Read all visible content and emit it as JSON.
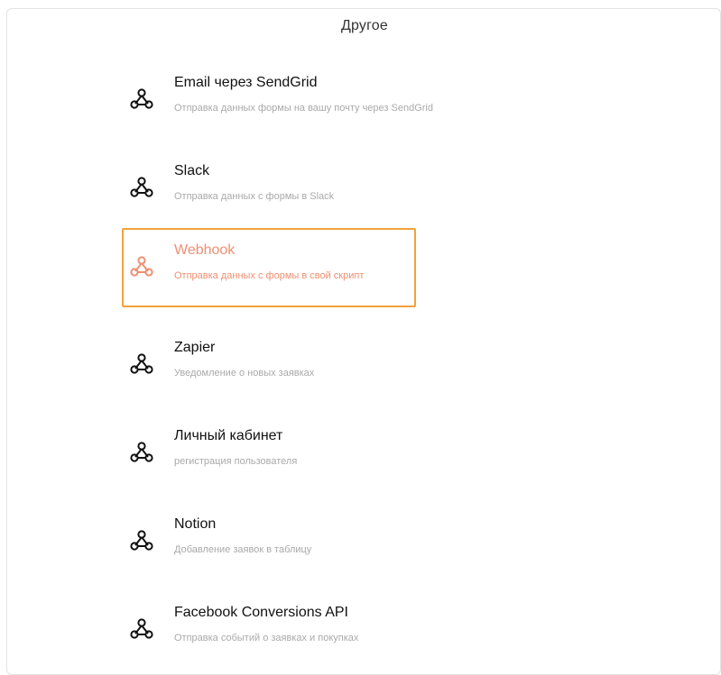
{
  "section_title": "Другое",
  "colors": {
    "highlight_border": "#f2a23a",
    "highlight_text": "#ef8f71",
    "title_text": "#111111",
    "desc_text": "#a9a9a9"
  },
  "items": [
    {
      "title": "Email через SendGrid",
      "desc": "Отправка данных формы на вашу почту через SendGrid",
      "icon": "webhook-icon",
      "active": false
    },
    {
      "title": "Slack",
      "desc": "Отправка данных с формы в Slack",
      "icon": "webhook-icon",
      "active": false
    },
    {
      "title": "Webhook",
      "desc": "Отправка данных с формы в свой скрипт",
      "icon": "webhook-icon",
      "active": true
    },
    {
      "title": "Zapier",
      "desc": "Уведомление о новых заявках",
      "icon": "webhook-icon",
      "active": false
    },
    {
      "title": "Личный кабинет",
      "desc": "регистрация пользователя",
      "icon": "webhook-icon",
      "active": false
    },
    {
      "title": "Notion",
      "desc": "Добавление заявок в таблицу",
      "icon": "webhook-icon",
      "active": false
    },
    {
      "title": "Facebook Conversions API",
      "desc": "Отправка событий о заявках и покупках",
      "icon": "webhook-icon",
      "active": false
    }
  ]
}
